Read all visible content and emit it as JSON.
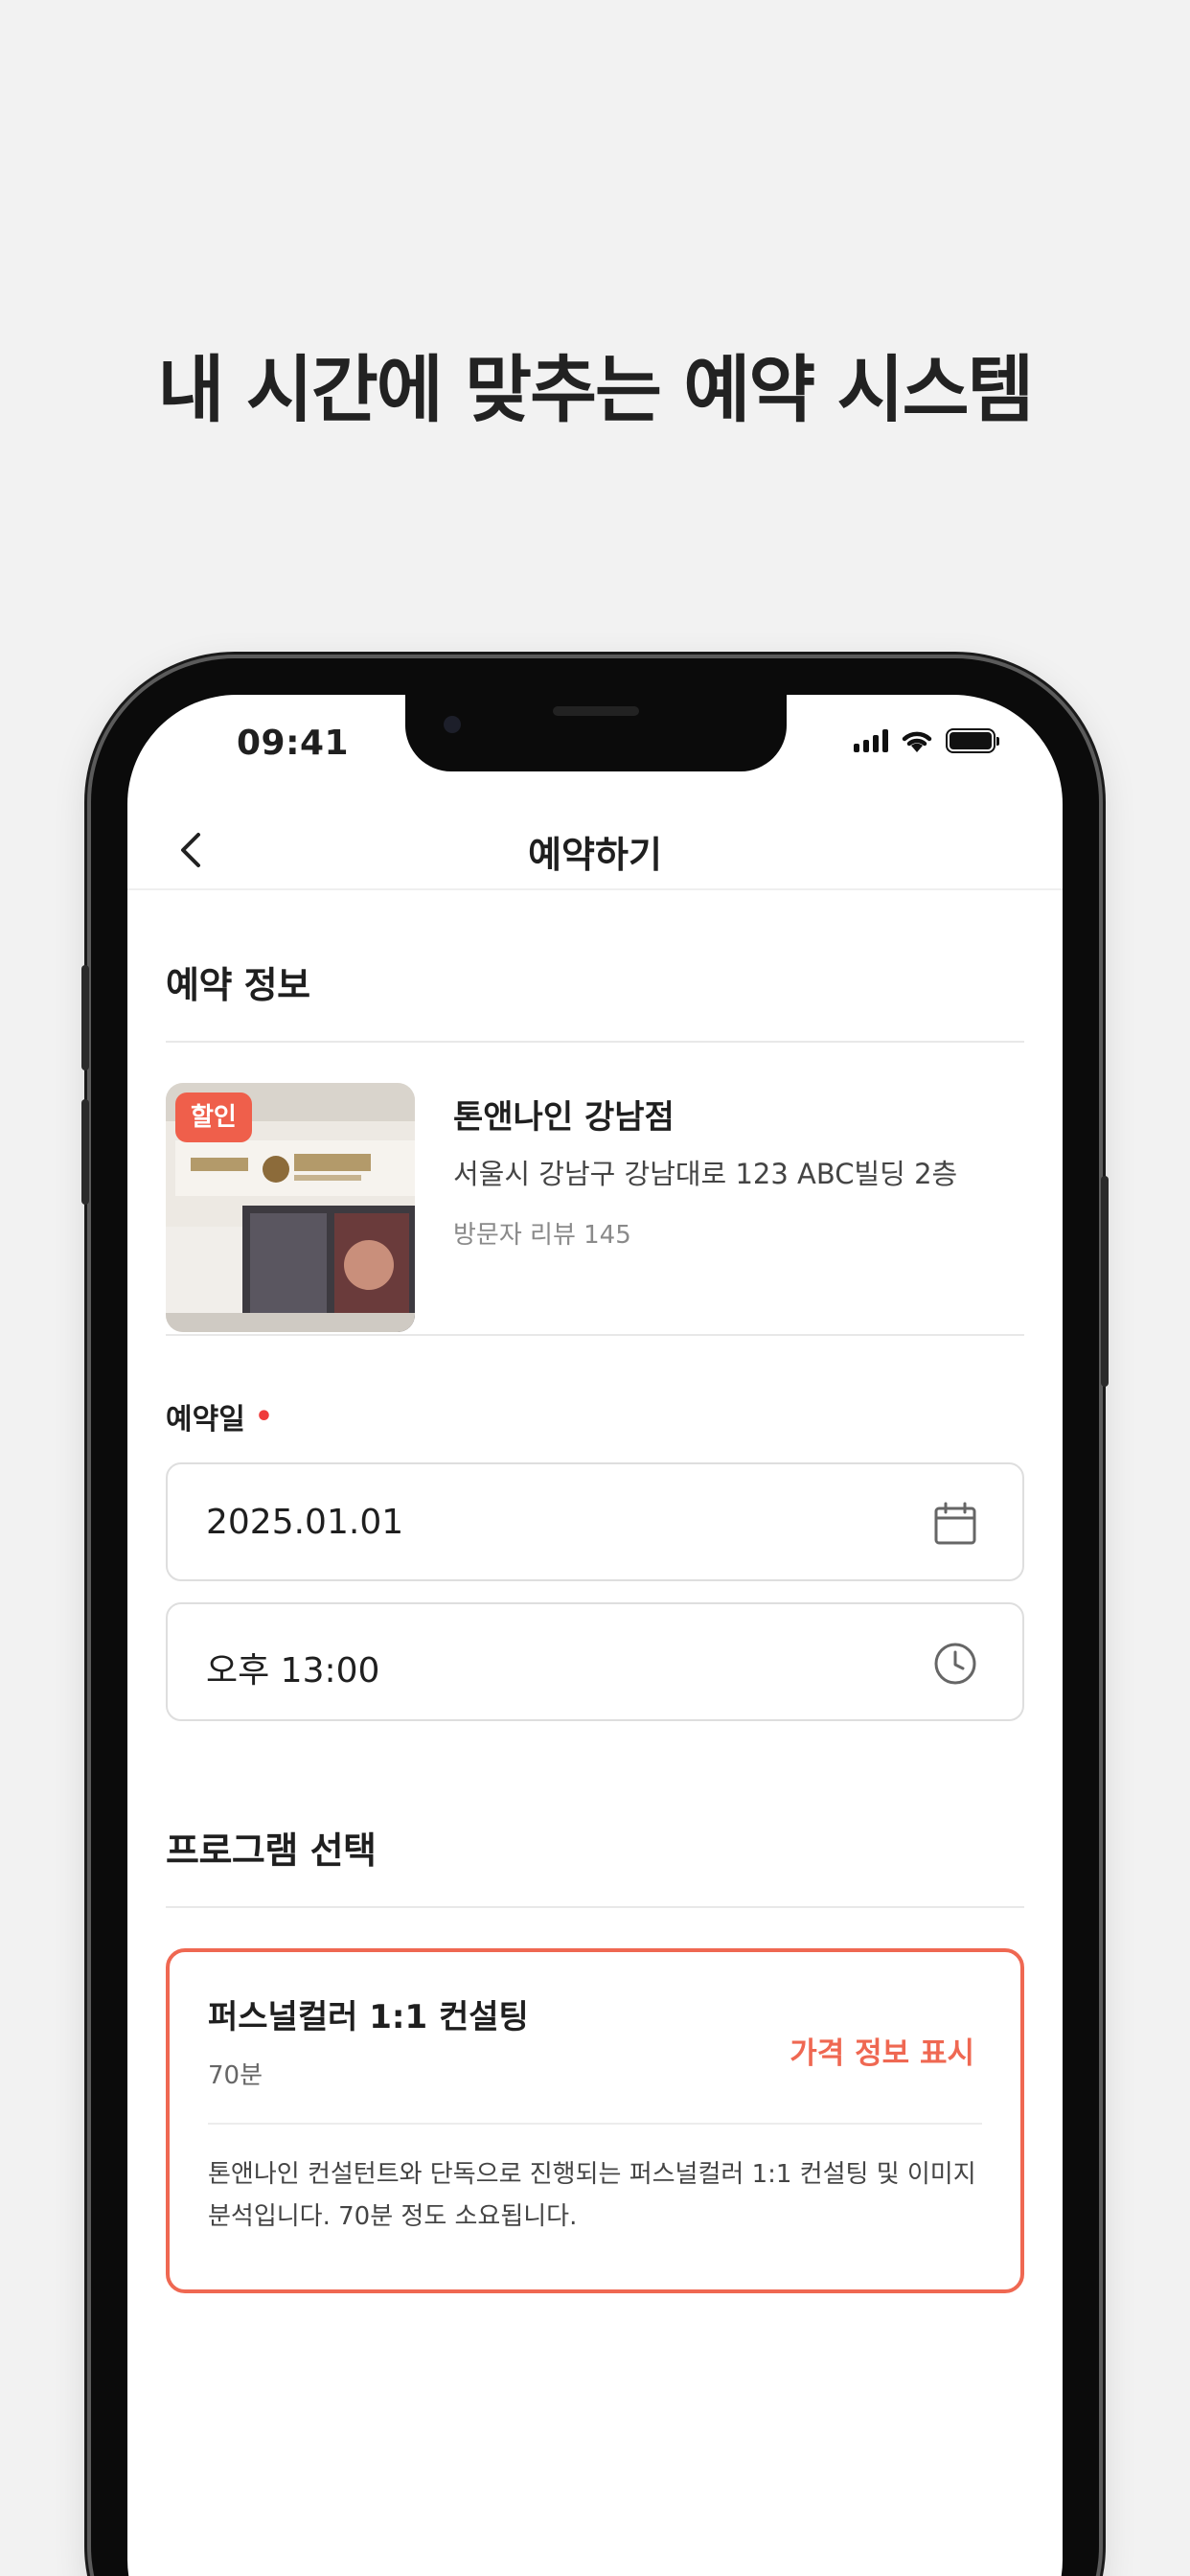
{
  "headline": "내 시간에 맞추는 예약 시스템",
  "status_bar": {
    "time": "09:41"
  },
  "header": {
    "title": "예약하기"
  },
  "reservation_info": {
    "section_title": "예약 정보",
    "store": {
      "badge": "할인",
      "name": "톤앤나인 강남점",
      "address": "서울시 강남구 강남대로 123 ABC빌딩 2층",
      "reviews": "방문자 리뷰 145"
    }
  },
  "reservation_date": {
    "label": "예약일",
    "required_mark": "•",
    "date_value": "2025.01.01",
    "time_value": "오후 13:00"
  },
  "program": {
    "section_title": "프로그램 선택",
    "card": {
      "name": "퍼스널컬러 1:1 컨설팅",
      "duration": "70분",
      "price_label": "가격 정보 표시",
      "description": "톤앤나인 컨설턴트와 단독으로 진행되는 퍼스널컬러 1:1 컨설팅 및 이미지 분석입니다. 70분 정도 소요됩니다."
    }
  },
  "colors": {
    "accent": "#ef6852",
    "badge": "#ef5f4b",
    "required": "#ef3b3b"
  }
}
